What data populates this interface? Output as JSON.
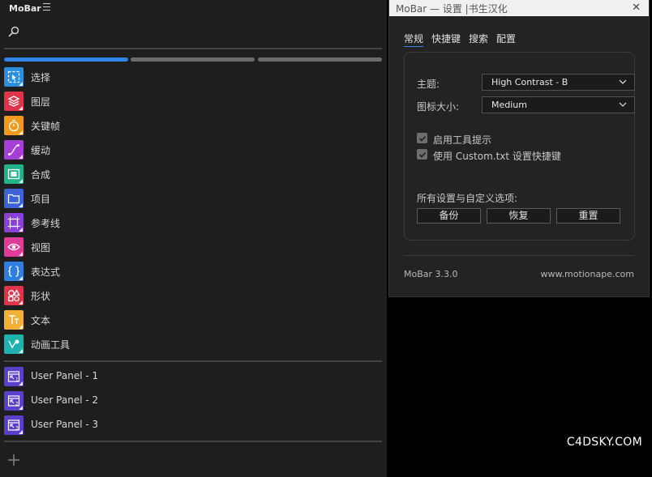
{
  "panel": {
    "title": "MoBar",
    "colors": {
      "active_tab": "#2f86e6",
      "inactive_tab": "#6b6b6b"
    },
    "tools": [
      {
        "label": "选择",
        "icon": "selection-icon",
        "color": "#2b8fe0"
      },
      {
        "label": "图层",
        "icon": "layers-icon",
        "color": "#e0344a"
      },
      {
        "label": "关键帧",
        "icon": "stopwatch-icon",
        "color": "#f39a1c"
      },
      {
        "label": "缓动",
        "icon": "easing-curve-icon",
        "color": "#a63fd6"
      },
      {
        "label": "合成",
        "icon": "composition-film-icon",
        "color": "#22b28a"
      },
      {
        "label": "项目",
        "icon": "folder-icon",
        "color": "#3d63d6"
      },
      {
        "label": "参考线",
        "icon": "guides-icon",
        "color": "#8a3fd6"
      },
      {
        "label": "视图",
        "icon": "eye-icon",
        "color": "#e03a9a"
      },
      {
        "label": "表达式",
        "icon": "braces-icon",
        "color": "#2f7fe0"
      },
      {
        "label": "形状",
        "icon": "shapes-icon",
        "color": "#e0344a"
      },
      {
        "label": "文本",
        "icon": "text-icon",
        "color": "#f2b134"
      },
      {
        "label": "动画工具",
        "icon": "animation-tools-icon",
        "color": "#1fb3b0"
      }
    ],
    "user_panels": [
      {
        "label": "User Panel - 1",
        "icon": "user-panel-1-icon",
        "color": "#5b3fc8"
      },
      {
        "label": "User Panel - 2",
        "icon": "user-panel-2-icon",
        "color": "#5b3fc8"
      },
      {
        "label": "User Panel - 3",
        "icon": "user-panel-3-icon",
        "color": "#5b3fc8"
      }
    ]
  },
  "settings": {
    "title": "MoBar — 设置 |书生汉化",
    "close": "✕",
    "tabs": [
      "常规",
      "快捷键",
      "搜索",
      "配置"
    ],
    "active_tab": "常规",
    "theme_label": "主题:",
    "theme_value": "High Contrast - B",
    "icon_size_label": "图标大小:",
    "icon_size_value": "Medium",
    "tooltips_label": "启用工具提示",
    "tooltips_checked": true,
    "custom_shortcuts_label": "使用 Custom.txt 设置快捷键",
    "custom_shortcuts_checked": true,
    "all_settings_label": "所有设置与自定义选项:",
    "backup_button": "备份",
    "restore_button": "恢复",
    "reset_button": "重置",
    "version": "MoBar 3.3.0",
    "website": "www.motionape.com"
  },
  "watermark": "C4DSKY.COM"
}
